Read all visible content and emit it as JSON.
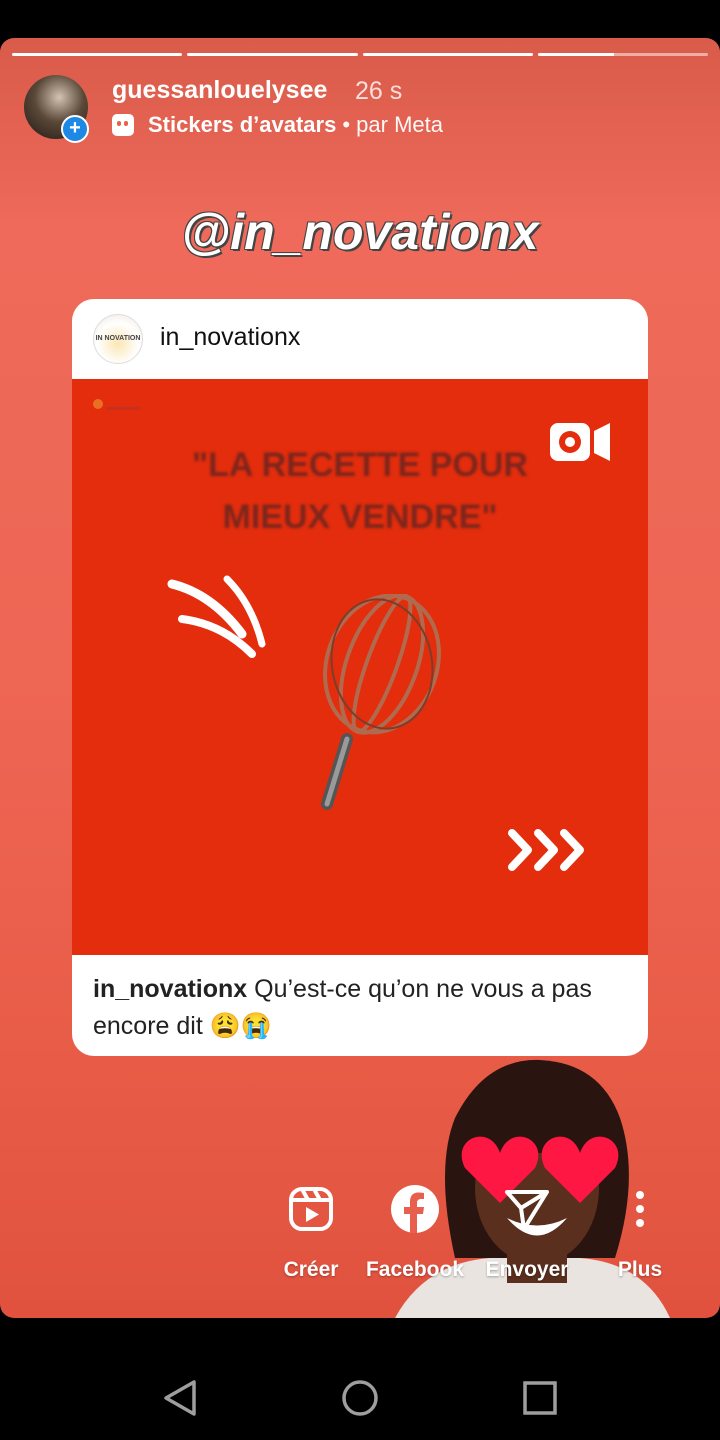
{
  "story": {
    "progress": [
      1,
      1,
      1,
      0.45
    ],
    "author": "guessanlouelysee",
    "time_ago": "26 s",
    "sticker_label": "Stickers d’avatars",
    "sticker_suffix": "• par Meta"
  },
  "mention": "@in_novationx",
  "post": {
    "username": "in_novationx",
    "logo_text": "IN NOVATION",
    "image_title_line1": "\"LA RECETTE POUR",
    "image_title_line2": "MIEUX VENDRE\"",
    "caption_user": "in_novationx",
    "caption_text": "Qu’est-ce qu’on ne vous a pas encore dit 😩😭"
  },
  "actions": {
    "create": "Créer",
    "facebook": "Facebook",
    "send": "Envoyer",
    "more": "Plus"
  },
  "colors": {
    "story_bg": "#ee6654",
    "post_bg": "#e32d0c",
    "title_text": "#7c261d",
    "badge_blue": "#1e88e5"
  },
  "icons": [
    "plus-icon",
    "sticker-icon",
    "reel-icon",
    "whisk-icon",
    "arrows-icon",
    "reels-create-icon",
    "facebook-icon",
    "send-icon",
    "more-icon",
    "back-icon",
    "home-icon",
    "recents-icon"
  ]
}
